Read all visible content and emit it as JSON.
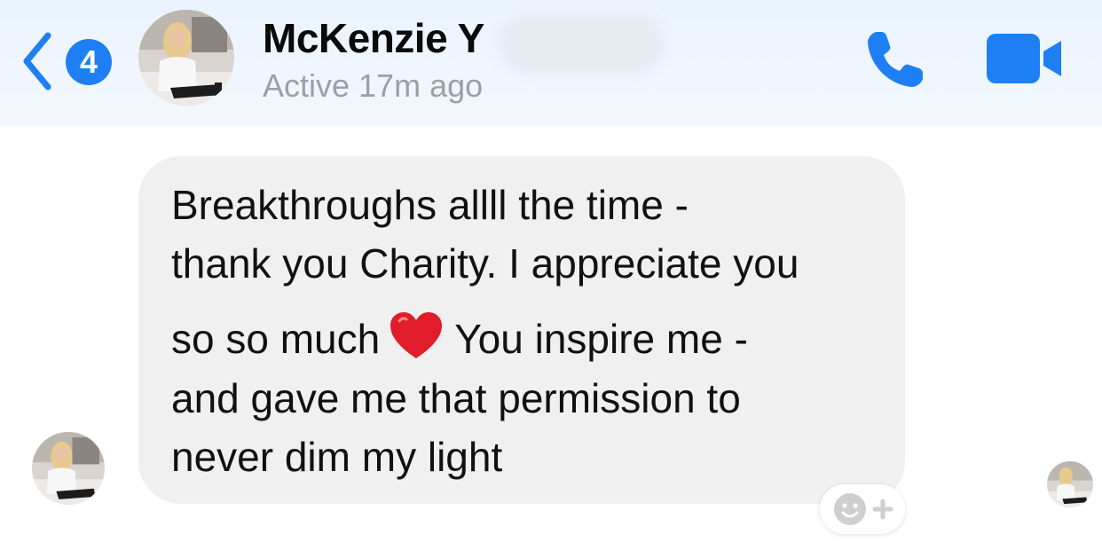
{
  "header": {
    "back_badge_count": "4",
    "contact_name": "McKenzie Y",
    "status": "Active 17m ago",
    "call_icon": "phone-icon",
    "video_icon": "video-camera-icon",
    "accent_color": "#1d7ff3"
  },
  "message": {
    "lines": [
      "Breakthroughs allll the time -",
      "thank you Charity. I appreciate you",
      "so so much",
      "You inspire me -",
      "and gave me that permission to",
      "never dim my light"
    ],
    "emoji": "red-heart-emoji",
    "bubble_color": "#f0f0f0"
  },
  "reaction_button": {
    "icon": "smiley-add-reaction-icon"
  }
}
